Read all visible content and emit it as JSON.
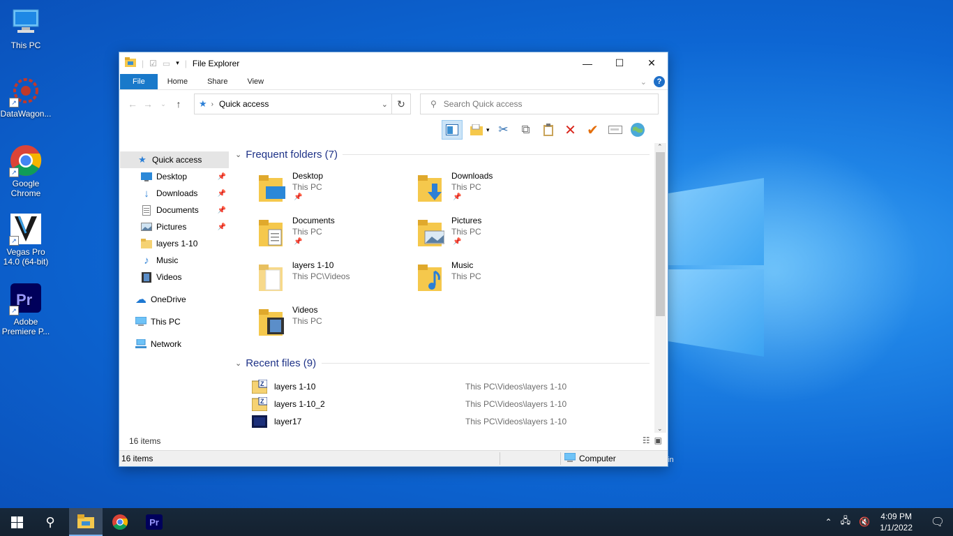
{
  "desktop": {
    "icons": [
      {
        "label": "This PC"
      },
      {
        "label": "DataWagon..."
      },
      {
        "label": "Google Chrome"
      },
      {
        "label": "Vegas Pro 14.0 (64-bit)"
      },
      {
        "label": "Adobe Premiere P..."
      }
    ],
    "partial_text": "in"
  },
  "window": {
    "title": "File Explorer",
    "ribbon_tabs": [
      "File",
      "Home",
      "Share",
      "View"
    ],
    "help_label": "?",
    "address": {
      "location": "Quick access"
    },
    "search_placeholder": "Search Quick access"
  },
  "sidebar": {
    "quick_access": "Quick access",
    "pinned": [
      "Desktop",
      "Downloads",
      "Documents",
      "Pictures"
    ],
    "others": [
      "layers 1-10",
      "Music",
      "Videos"
    ],
    "onedrive": "OneDrive",
    "this_pc": "This PC",
    "network": "Network"
  },
  "frequent": {
    "header": "Frequent folders (7)",
    "folders": [
      {
        "name": "Desktop",
        "location": "This PC",
        "pinned": true
      },
      {
        "name": "Downloads",
        "location": "This PC",
        "pinned": true
      },
      {
        "name": "Documents",
        "location": "This PC",
        "pinned": true
      },
      {
        "name": "Pictures",
        "location": "This PC",
        "pinned": true
      },
      {
        "name": "layers 1-10",
        "location": "This PC\\Videos",
        "pinned": false
      },
      {
        "name": "Music",
        "location": "This PC",
        "pinned": false
      },
      {
        "name": "Videos",
        "location": "This PC",
        "pinned": false
      }
    ]
  },
  "recent": {
    "header": "Recent files (9)",
    "files": [
      {
        "name": "layers 1-10",
        "location": "This PC\\Videos\\layers 1-10"
      },
      {
        "name": "layers 1-10_2",
        "location": "This PC\\Videos\\layers 1-10"
      },
      {
        "name": "layer17",
        "location": "This PC\\Videos\\layers 1-10"
      }
    ]
  },
  "status": {
    "items_count": "16 items",
    "items_count_bottom": "16 items",
    "computer": "Computer"
  },
  "taskbar": {
    "time": "4:09 PM",
    "date": "1/1/2022",
    "pr_label": "Pr"
  },
  "colors": {
    "accent": "#1979ca",
    "header_text": "#1e3287",
    "folder": "#f5c84c"
  }
}
